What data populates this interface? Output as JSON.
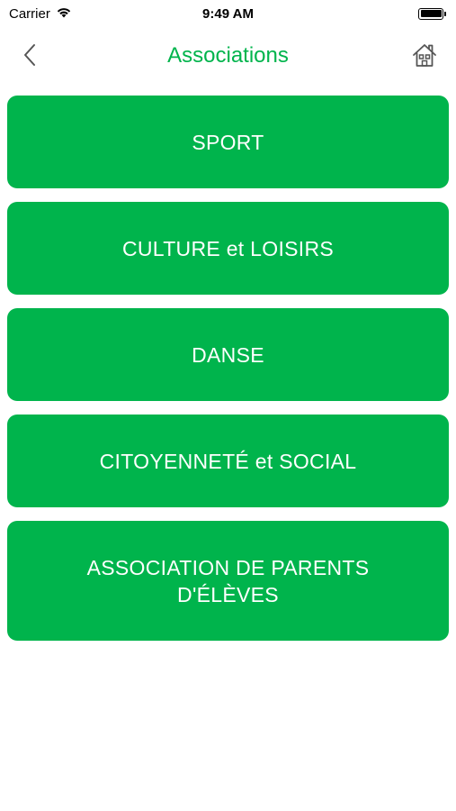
{
  "status_bar": {
    "carrier": "Carrier",
    "time": "9:49 AM",
    "wifi_icon": "wifi-icon",
    "battery_icon": "battery-icon"
  },
  "nav": {
    "title": "Associations",
    "back_icon": "chevron-left-icon",
    "home_icon": "home-icon"
  },
  "categories": [
    {
      "label": "SPORT"
    },
    {
      "label": "CULTURE et LOISIRS"
    },
    {
      "label": "DANSE"
    },
    {
      "label": "CITOYENNETÉ et SOCIAL"
    },
    {
      "label": "ASSOCIATION DE PARENTS D'ÉLÈVES"
    }
  ],
  "colors": {
    "accent": "#00b44c",
    "button_text": "#ffffff",
    "background": "#ffffff",
    "icon": "#555555"
  }
}
